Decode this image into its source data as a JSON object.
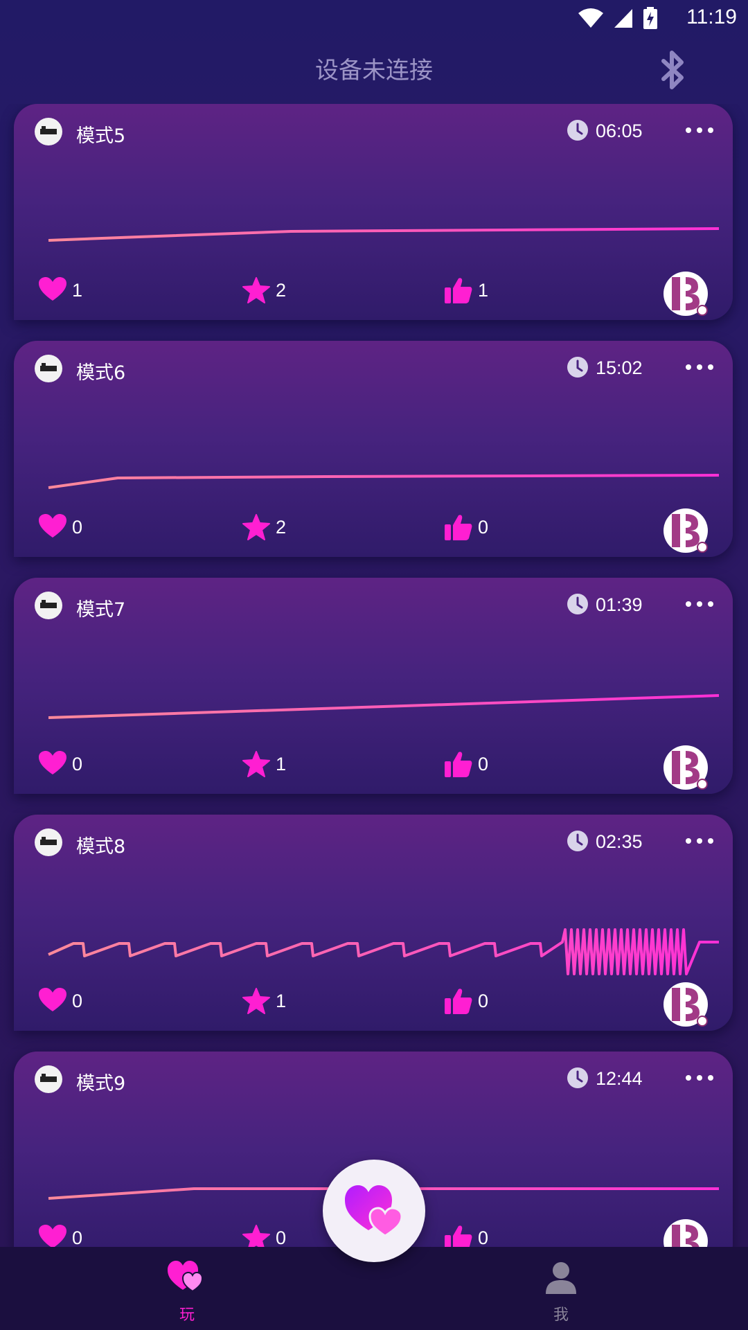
{
  "status_bar": {
    "time": "11:19"
  },
  "header": {
    "title": "设备未连接",
    "bluetooth_icon": "bluetooth-icon"
  },
  "colors": {
    "accent": "#ff1fd2",
    "wave_start": "#ff8a9a",
    "wave_end": "#ff2fd6",
    "card_top": "#5e2384",
    "card_bottom": "#301b6a",
    "nav_bg": "#1b0f3f"
  },
  "cards": [
    {
      "title": "模式5",
      "duration": "06:05",
      "likes": "1",
      "favorites": "2",
      "thumbs": "1"
    },
    {
      "title": "模式6",
      "duration": "15:02",
      "likes": "0",
      "favorites": "2",
      "thumbs": "0"
    },
    {
      "title": "模式7",
      "duration": "01:39",
      "likes": "0",
      "favorites": "1",
      "thumbs": "0"
    },
    {
      "title": "模式8",
      "duration": "02:35",
      "likes": "0",
      "favorites": "1",
      "thumbs": "0"
    },
    {
      "title": "模式9",
      "duration": "12:44",
      "likes": "0",
      "favorites": "0",
      "thumbs": "0"
    }
  ],
  "nav": {
    "play_label": "玩",
    "me_label": "我"
  }
}
